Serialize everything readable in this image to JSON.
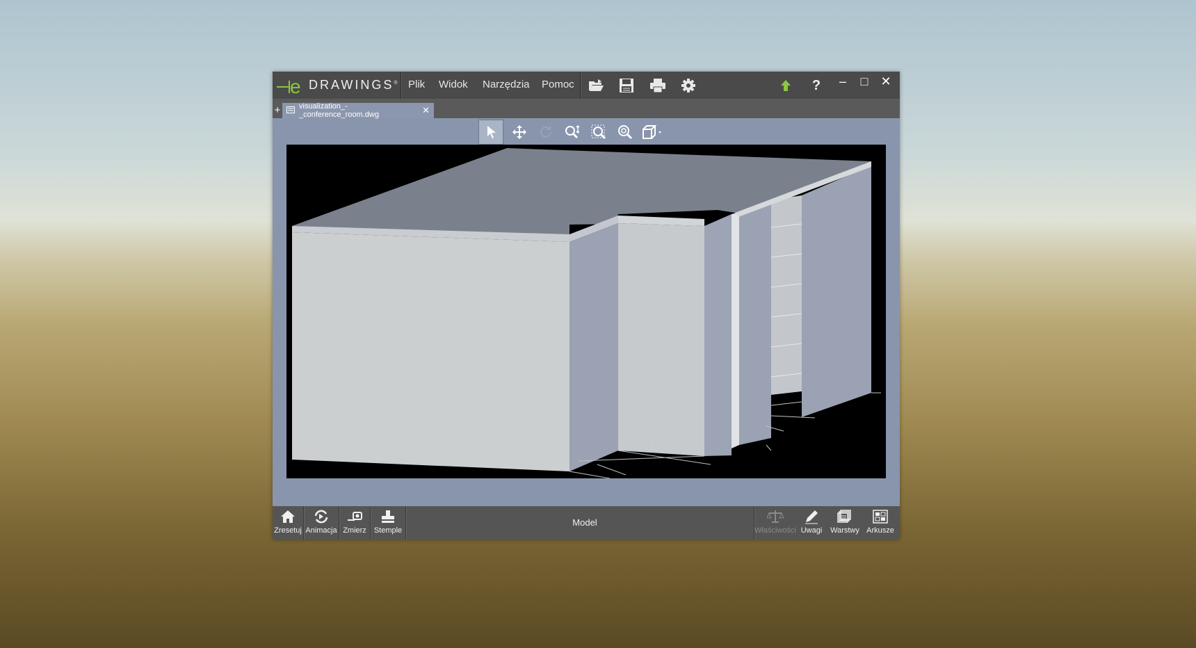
{
  "app": {
    "logo_text": "DRAWINGS",
    "logo_reg": "®"
  },
  "menu": {
    "file": "Plik",
    "view": "Widok",
    "tools": "Narzędzia",
    "help": "Pomoc"
  },
  "toolbar": {
    "icons": [
      "folder-open-icon",
      "save-icon",
      "print-icon",
      "gear-icon",
      "upload-arrow-icon",
      "help-icon"
    ],
    "help_label": "?"
  },
  "window_controls": {
    "minimize": "–",
    "maximize": "□",
    "close": "✕"
  },
  "tabs": {
    "add_label": "+",
    "active_document": "visualization_-_conference_room.dwg",
    "close_label": "✕"
  },
  "view_tools": [
    "select-arrow-icon",
    "pan-icon",
    "rotate-icon",
    "zoom-fit-icon",
    "zoom-area-icon",
    "zoom-icon",
    "view-cube-icon"
  ],
  "bottom": {
    "reset": "Zresetuj",
    "animation": "Animacja",
    "measure": "Zmierz",
    "stamps": "Stemple",
    "mode": "Model",
    "properties": "Właściwości",
    "notes": "Uwagi",
    "layers": "Warstwy",
    "sheets": "Arkusze"
  },
  "colors": {
    "logo_green": "#8dc63f",
    "title_bar": "#4a4a4a",
    "window_bg": "#8995ad",
    "viewport_bg": "#000000",
    "upload_arrow": "#8dc63f"
  }
}
